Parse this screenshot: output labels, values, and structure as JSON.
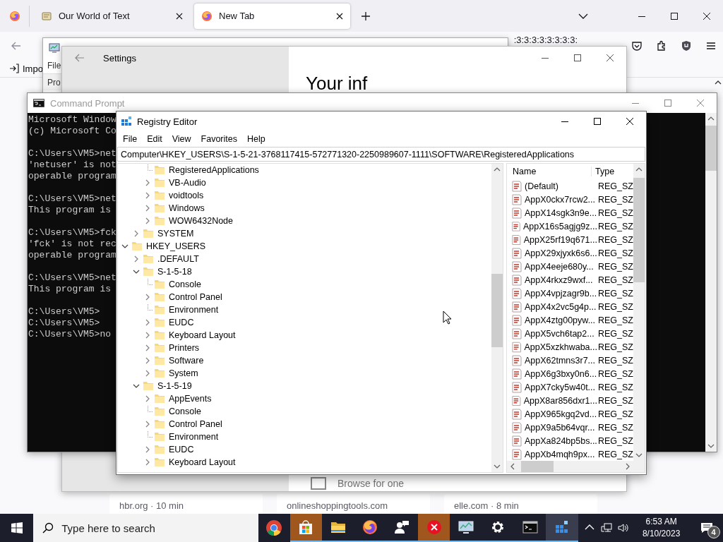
{
  "browser": {
    "tabs": [
      {
        "label": "Our World of Text",
        "selected": false,
        "kind": "page"
      },
      {
        "label": "New Tab",
        "selected": true,
        "kind": "firefox"
      }
    ],
    "address_text": ":3:3:3:3:3:3:3:3:",
    "bookmark": "Impo",
    "cards": [
      "hbr.org · 10 min",
      "onlineshoppingtools.com",
      "elle.com · 8 min"
    ]
  },
  "task_manager": {
    "menu": [
      "File"
    ],
    "tab": "Pro"
  },
  "settings": {
    "title": "Settings",
    "heading": "Your inf",
    "checkbox": {
      "label": "Browse for one",
      "checked": false
    }
  },
  "cmd": {
    "title": "Command Prompt",
    "blocks": [
      [
        "Microsoft Window",
        "(c) Microsoft Co"
      ],
      [
        "C:\\Users\\VM5>net",
        "'netuser' is not",
        "operable program"
      ],
      [
        "C:\\Users\\VM5>net",
        "This program is"
      ],
      [
        "C:\\Users\\VM5>fck",
        "'fck' is not rec",
        "operable program"
      ],
      [
        "C:\\Users\\VM5>net",
        "This program is"
      ],
      [
        "C:\\Users\\VM5>",
        "C:\\Users\\VM5>",
        "C:\\Users\\VM5>no"
      ]
    ]
  },
  "regedit": {
    "title": "Registry Editor",
    "menu": [
      "File",
      "Edit",
      "View",
      "Favorites",
      "Help"
    ],
    "address": "Computer\\HKEY_USERS\\S-1-5-21-3768117415-572771320-2250989607-1111\\SOFTWARE\\RegisteredApplications",
    "tree": [
      {
        "children": [
          {
            "children": [
              {
                "name": "RegisteredApplications",
                "kind": "leaf"
              },
              {
                "name": "VB-Audio",
                "kind": "branch",
                "expanded": false
              },
              {
                "name": "voidtools",
                "kind": "branch",
                "expanded": false
              },
              {
                "name": "Windows",
                "kind": "branch",
                "expanded": false
              },
              {
                "name": "WOW6432Node",
                "kind": "branch",
                "expanded": false
              }
            ]
          },
          {
            "name": "SYSTEM",
            "kind": "branch",
            "expanded": false
          }
        ]
      },
      {
        "name": "HKEY_USERS",
        "kind": "branch",
        "expanded": true,
        "children": [
          {
            "name": ".DEFAULT",
            "kind": "branch",
            "expanded": false
          },
          {
            "name": "S-1-5-18",
            "kind": "branch",
            "expanded": true,
            "children": [
              {
                "name": "Console",
                "kind": "leaf"
              },
              {
                "name": "Control Panel",
                "kind": "branch",
                "expanded": false
              },
              {
                "name": "Environment",
                "kind": "leaf"
              },
              {
                "name": "EUDC",
                "kind": "branch",
                "expanded": false
              },
              {
                "name": "Keyboard Layout",
                "kind": "branch",
                "expanded": false
              },
              {
                "name": "Printers",
                "kind": "branch",
                "expanded": false
              },
              {
                "name": "Software",
                "kind": "branch",
                "expanded": false
              },
              {
                "name": "System",
                "kind": "branch",
                "expanded": false
              }
            ]
          },
          {
            "name": "S-1-5-19",
            "kind": "branch",
            "expanded": true,
            "children": [
              {
                "name": "AppEvents",
                "kind": "branch",
                "expanded": false
              },
              {
                "name": "Console",
                "kind": "leaf"
              },
              {
                "name": "Control Panel",
                "kind": "branch",
                "expanded": false
              },
              {
                "name": "Environment",
                "kind": "leaf"
              },
              {
                "name": "EUDC",
                "kind": "branch",
                "expanded": false
              },
              {
                "name": "Keyboard Layout",
                "kind": "branch",
                "expanded": false
              }
            ]
          }
        ]
      }
    ],
    "columns": [
      "Name",
      "Type"
    ],
    "values": [
      {
        "name": "(Default)",
        "type": "REG_SZ"
      },
      {
        "name": "AppX0ckx7rcw2...",
        "type": "REG_SZ"
      },
      {
        "name": "AppX14sgk3n9e...",
        "type": "REG_SZ"
      },
      {
        "name": "AppX16s5agjg9z...",
        "type": "REG_SZ"
      },
      {
        "name": "AppX25rf19q671...",
        "type": "REG_SZ"
      },
      {
        "name": "AppX29xjyxk6s6...",
        "type": "REG_SZ"
      },
      {
        "name": "AppX4eeje680y...",
        "type": "REG_SZ"
      },
      {
        "name": "AppX4rkxz9wxf...",
        "type": "REG_SZ"
      },
      {
        "name": "AppX4vpjzagr9b...",
        "type": "REG_SZ"
      },
      {
        "name": "AppX4x2vc5g4p...",
        "type": "REG_SZ"
      },
      {
        "name": "AppX4ztg00pyw...",
        "type": "REG_SZ"
      },
      {
        "name": "AppX5vch6tap2...",
        "type": "REG_SZ"
      },
      {
        "name": "AppX5xzkhwaba...",
        "type": "REG_SZ"
      },
      {
        "name": "AppX62tmns3r7...",
        "type": "REG_SZ"
      },
      {
        "name": "AppX6g3bxy0n6...",
        "type": "REG_SZ"
      },
      {
        "name": "AppX7cky5w40t...",
        "type": "REG_SZ"
      },
      {
        "name": "AppX8ar856dxr1...",
        "type": "REG_SZ"
      },
      {
        "name": "AppX965kgq2vd...",
        "type": "REG_SZ"
      },
      {
        "name": "AppX9a5b64vqr...",
        "type": "REG_SZ"
      },
      {
        "name": "AppXa824bp5bs...",
        "type": "REG_SZ"
      },
      {
        "name": "AppXb4mqh9px...",
        "type": "REG_SZ"
      }
    ]
  },
  "taskbar": {
    "search_placeholder": "Type here to search",
    "apps": [
      {
        "kind": "chrome",
        "open": false,
        "flashing": false,
        "selected": false
      },
      {
        "kind": "store",
        "open": true,
        "flashing": true,
        "selected": false
      },
      {
        "kind": "explorer",
        "open": true,
        "flashing": false,
        "selected": false
      },
      {
        "kind": "firefox",
        "open": true,
        "flashing": false,
        "selected": false
      },
      {
        "kind": "people",
        "open": true,
        "flashing": false,
        "selected": false
      },
      {
        "kind": "error",
        "open": true,
        "flashing": true,
        "selected": false
      },
      {
        "kind": "taskmgr",
        "open": true,
        "flashing": false,
        "selected": false
      },
      {
        "kind": "settings",
        "open": true,
        "flashing": false,
        "selected": false
      },
      {
        "kind": "cmd",
        "open": true,
        "flashing": false,
        "selected": false
      },
      {
        "kind": "regedit",
        "open": true,
        "flashing": false,
        "selected": true
      }
    ],
    "time": "6:53 AM",
    "date": "8/10/2023",
    "notifications": "4"
  }
}
